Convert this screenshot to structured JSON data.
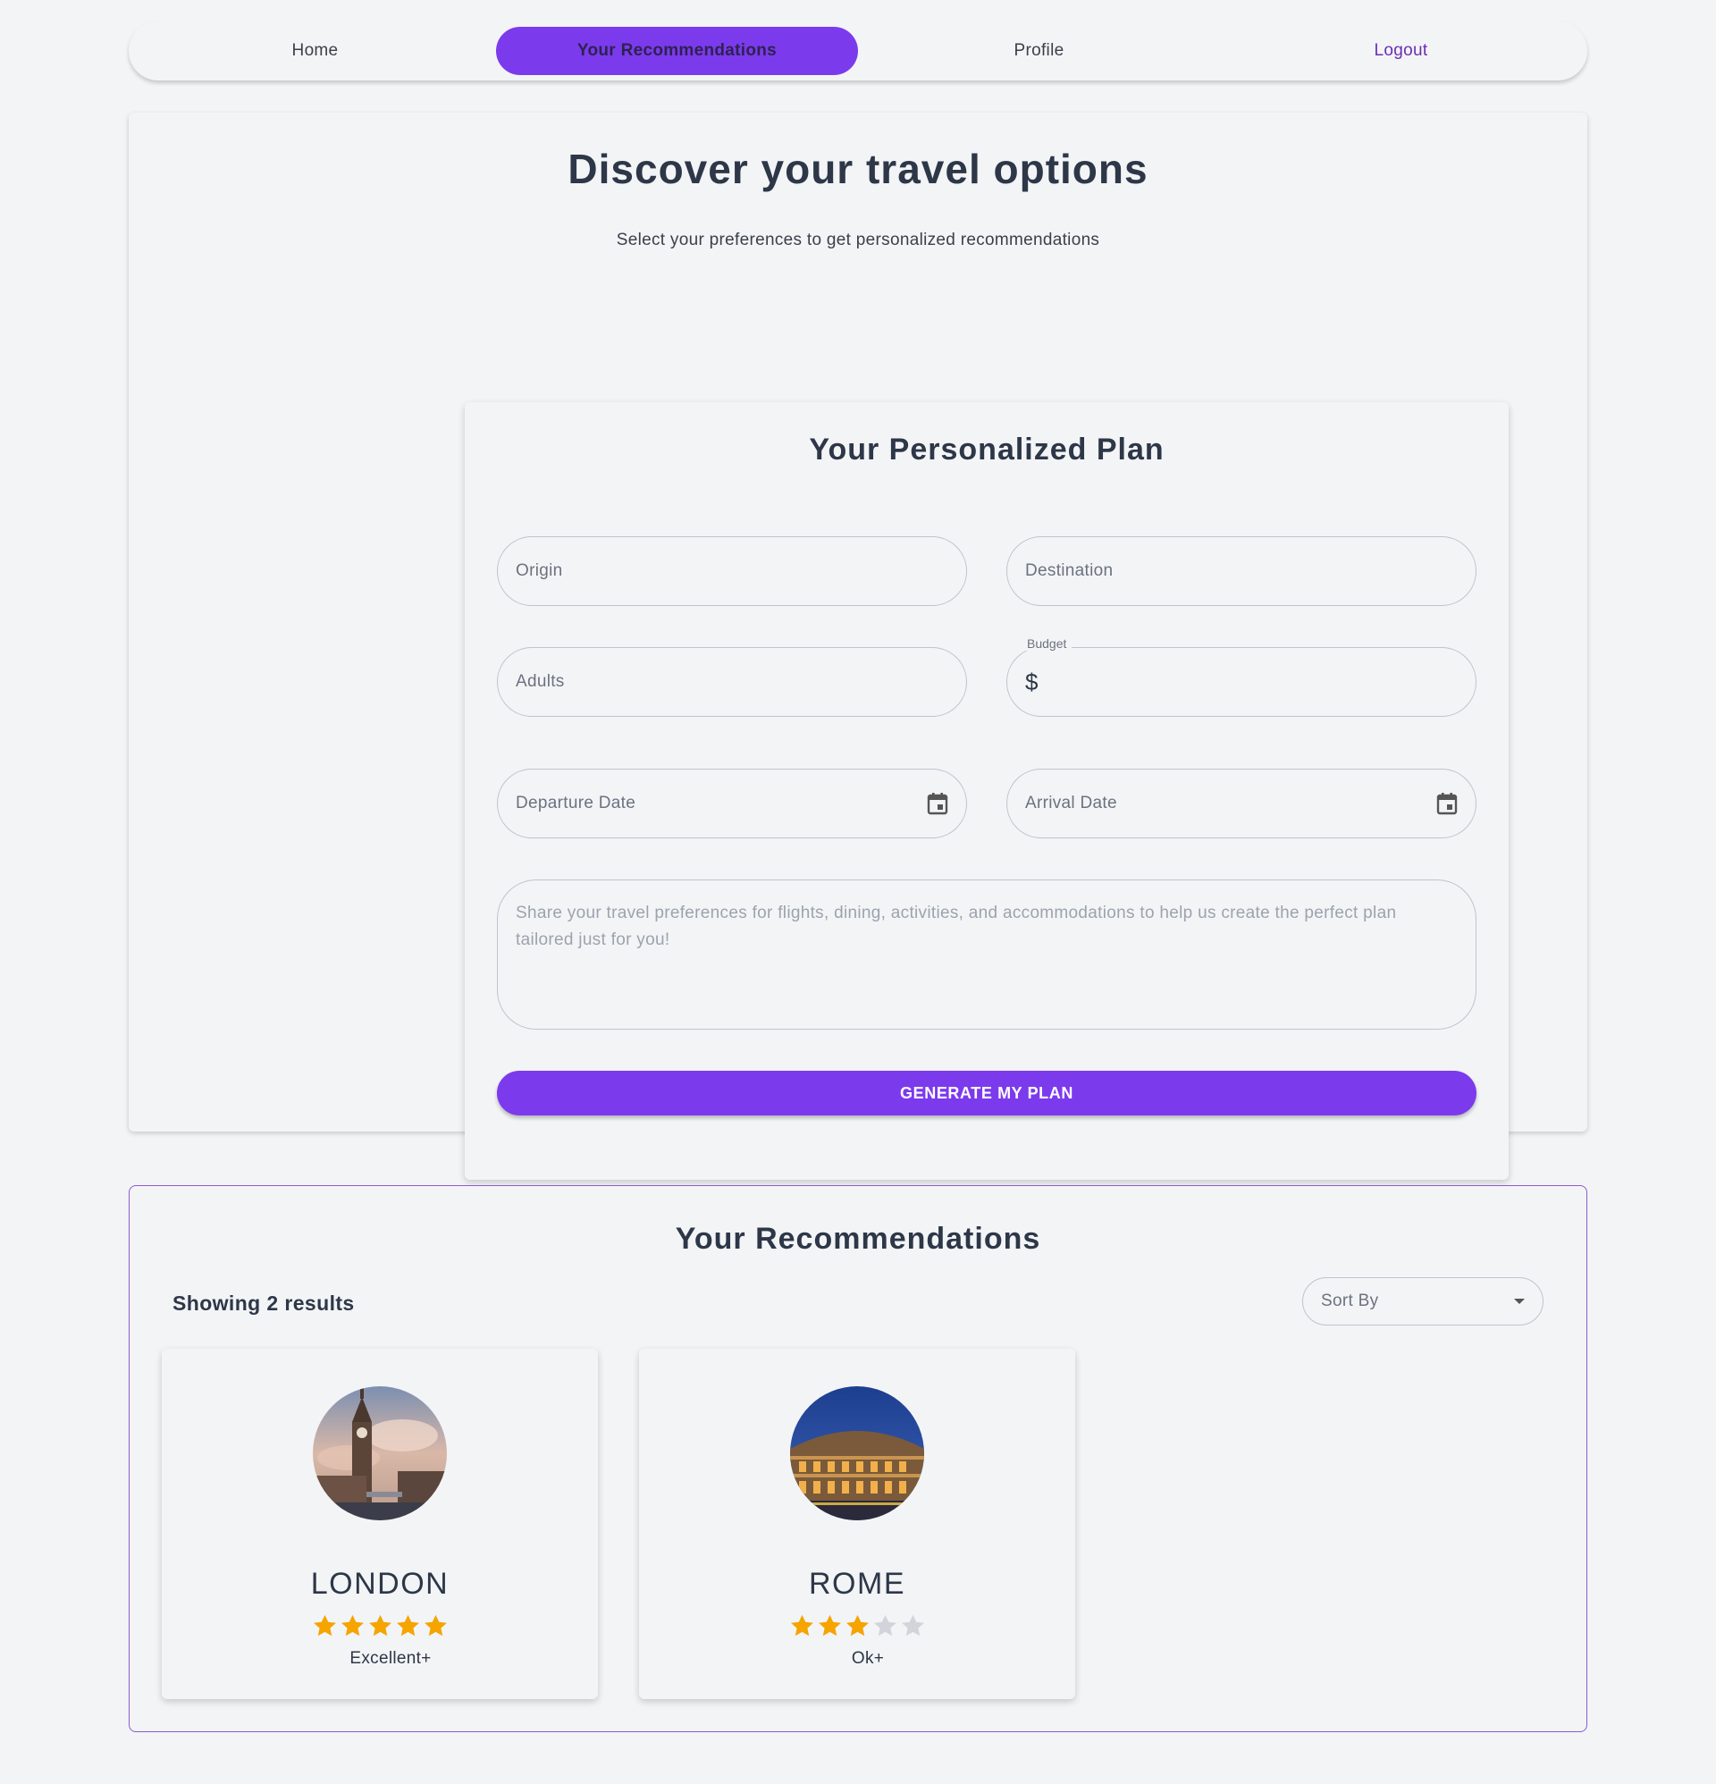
{
  "nav": {
    "items": [
      {
        "label": "Home",
        "name": "nav-home"
      },
      {
        "label": "Your Recommendations",
        "name": "nav-your-recommendations"
      },
      {
        "label": "Profile",
        "name": "nav-profile"
      },
      {
        "label": "Logout",
        "name": "nav-logout"
      }
    ],
    "active_index": 1
  },
  "hero": {
    "title": "Discover your travel options",
    "subtitle": "Select your preferences to get personalized recommendations"
  },
  "plan": {
    "title": "Your Personalized Plan",
    "fields": {
      "origin": {
        "placeholder": "Origin",
        "value": ""
      },
      "destination": {
        "placeholder": "Destination",
        "value": ""
      },
      "adults": {
        "placeholder": "Adults",
        "value": ""
      },
      "budget": {
        "label": "Budget",
        "prefix": "$",
        "value": ""
      },
      "departure_date": {
        "placeholder": "Departure Date",
        "value": "",
        "icon": "calendar-icon"
      },
      "arrival_date": {
        "placeholder": "Arrival Date",
        "value": "",
        "icon": "calendar-icon"
      },
      "preferences": {
        "placeholder": "Share your travel preferences for flights, dining, activities, and accommodations to help us create the perfect plan tailored just for you!",
        "value": ""
      }
    },
    "generate_label": "GENERATE MY PLAN"
  },
  "recommendations": {
    "title": "Your Recommendations",
    "count_text": "Showing 2 results",
    "sort_label": "Sort By",
    "results": [
      {
        "name": "LONDON",
        "rating": 5,
        "max_rating": 5,
        "rating_text": "Excellent+",
        "image": "big-ben-photo"
      },
      {
        "name": "ROME",
        "rating": 3,
        "max_rating": 5,
        "rating_text": "Ok+",
        "image": "colosseum-photo"
      }
    ]
  },
  "colors": {
    "accent": "#7c3aed",
    "star_filled": "#f5a400",
    "star_empty": "#d1d5db",
    "page_bg": "#f3f4f6",
    "text": "#2d3748"
  }
}
